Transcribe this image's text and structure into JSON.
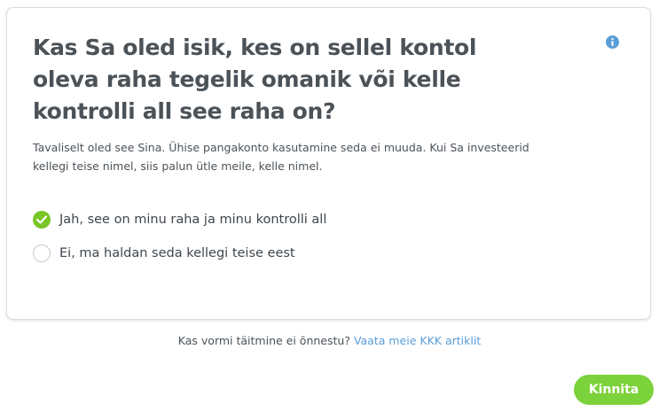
{
  "question": {
    "title": "Kas Sa oled isik, kes on sellel kontol oleva raha tegelik omanik või kelle kontrolli all see raha on?",
    "description": "Tavaliselt oled see Sina. Ühise pangakonto kasutamine seda ei muuda. Kui Sa investeerid kellegi teise nimel, siis palun ütle meile, kelle nimel."
  },
  "options": [
    {
      "label": "Jah, see on minu raha ja minu kontrolli all",
      "selected": true
    },
    {
      "label": "Ei, ma haldan seda kellegi teise eest",
      "selected": false
    }
  ],
  "help": {
    "text": "Kas vormi täitmine ei õnnestu?",
    "link": "Vaata meie KKK artiklit"
  },
  "actions": {
    "confirm_label": "Kinnita"
  },
  "colors": {
    "accent_green": "#7cd23a",
    "link_blue": "#5a9ed6",
    "text_dark": "#4b5258"
  },
  "icons": {
    "info": "info-icon",
    "selected": "check-icon"
  }
}
